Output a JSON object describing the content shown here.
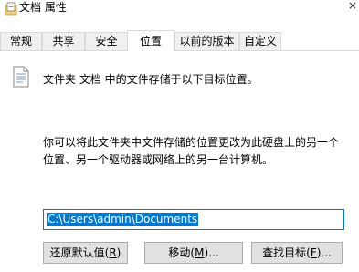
{
  "window": {
    "title": "文档 属性",
    "close_symbol": "×"
  },
  "tabs": [
    {
      "label": "常规"
    },
    {
      "label": "共享"
    },
    {
      "label": "安全"
    },
    {
      "label": "位置",
      "active": true
    },
    {
      "label": "以前的版本"
    },
    {
      "label": "自定义"
    }
  ],
  "location": {
    "description": "文件夹 文档 中的文件存储于以下目标位置。",
    "info_line1": "你可以将此文件夹中文件存储的位置更改为此硬盘上的另一个",
    "info_line2": "位置、另一个驱动器或网络上的另一台计算机。",
    "path_value": "C:\\Users\\admin\\Documents"
  },
  "buttons": {
    "restore_prefix": "还原默认值(",
    "restore_key": "R",
    "restore_suffix": ")",
    "move_prefix": "移动(",
    "move_key": "M",
    "move_suffix": ")...",
    "find_prefix": "查找目标(",
    "find_key": "F",
    "find_suffix": ")..."
  },
  "colors": {
    "accent": "#0078d7",
    "tab_border": "#d9d9d9",
    "button_bg": "#e1e1e1"
  }
}
